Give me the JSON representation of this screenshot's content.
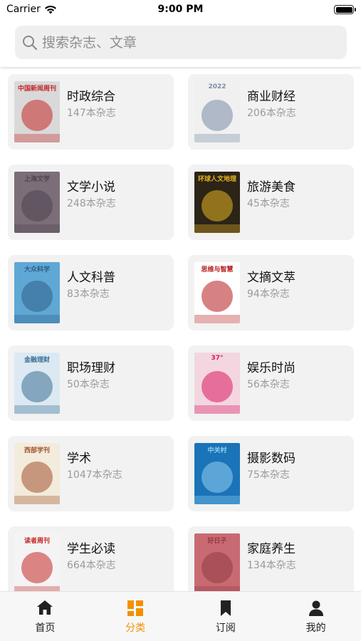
{
  "status": {
    "carrier": "Carrier",
    "time": "9:00 PM"
  },
  "search": {
    "placeholder": "搜索杂志、文章"
  },
  "categories": [
    {
      "title": "时政综合",
      "count": "147本杂志",
      "cover": {
        "masthead": "中国新闻周刊",
        "bg": "#d9d9d9",
        "accent": "#c62828"
      }
    },
    {
      "title": "商业财经",
      "count": "206本杂志",
      "cover": {
        "masthead": "2022",
        "bg": "#f0f0f0",
        "accent": "#7a8da6"
      }
    },
    {
      "title": "文学小说",
      "count": "248本杂志",
      "cover": {
        "masthead": "上海文学",
        "bg": "#7b6e79",
        "accent": "#4e4450"
      }
    },
    {
      "title": "旅游美食",
      "count": "45本杂志",
      "cover": {
        "masthead": "环球人文地理",
        "bg": "#2b2417",
        "accent": "#e6b422"
      }
    },
    {
      "title": "人文科普",
      "count": "83本杂志",
      "cover": {
        "masthead": "大众科学",
        "bg": "#5fa8d6",
        "accent": "#2f5f88"
      }
    },
    {
      "title": "文摘文萃",
      "count": "94本杂志",
      "cover": {
        "masthead": "思维与智慧",
        "bg": "#ffffff",
        "accent": "#b71c1c"
      }
    },
    {
      "title": "职场理财",
      "count": "50本杂志",
      "cover": {
        "masthead": "金融理财",
        "bg": "#dce9f2",
        "accent": "#3d6f96"
      }
    },
    {
      "title": "娱乐时尚",
      "count": "56本杂志",
      "cover": {
        "masthead": "37°",
        "bg": "#f3d6e0",
        "accent": "#d81b60"
      }
    },
    {
      "title": "学术",
      "count": "1047本杂志",
      "cover": {
        "masthead": "西部学刊",
        "bg": "#f3ebdc",
        "accent": "#a0522d"
      }
    },
    {
      "title": "摄影数码",
      "count": "75本杂志",
      "cover": {
        "masthead": "中关村",
        "bg": "#1b73b8",
        "accent": "#8fd0f0"
      }
    },
    {
      "title": "学生必读",
      "count": "664本杂志",
      "cover": {
        "masthead": "读者周刊",
        "bg": "#f4f4f4",
        "accent": "#c62828"
      }
    },
    {
      "title": "家庭养生",
      "count": "134本杂志",
      "cover": {
        "masthead": "好日子",
        "bg": "#c96a72",
        "accent": "#8f3a46"
      }
    }
  ],
  "tabs": [
    {
      "label": "首页",
      "icon": "home-icon",
      "active": false
    },
    {
      "label": "分类",
      "icon": "category-grid-icon",
      "active": true
    },
    {
      "label": "订阅",
      "icon": "bookmark-icon",
      "active": false
    },
    {
      "label": "我的",
      "icon": "person-icon",
      "active": false
    }
  ],
  "colors": {
    "accent": "#f29100",
    "card_bg": "#f2f2f2",
    "count_text": "#9a9a9a",
    "search_bg": "#efefef"
  }
}
